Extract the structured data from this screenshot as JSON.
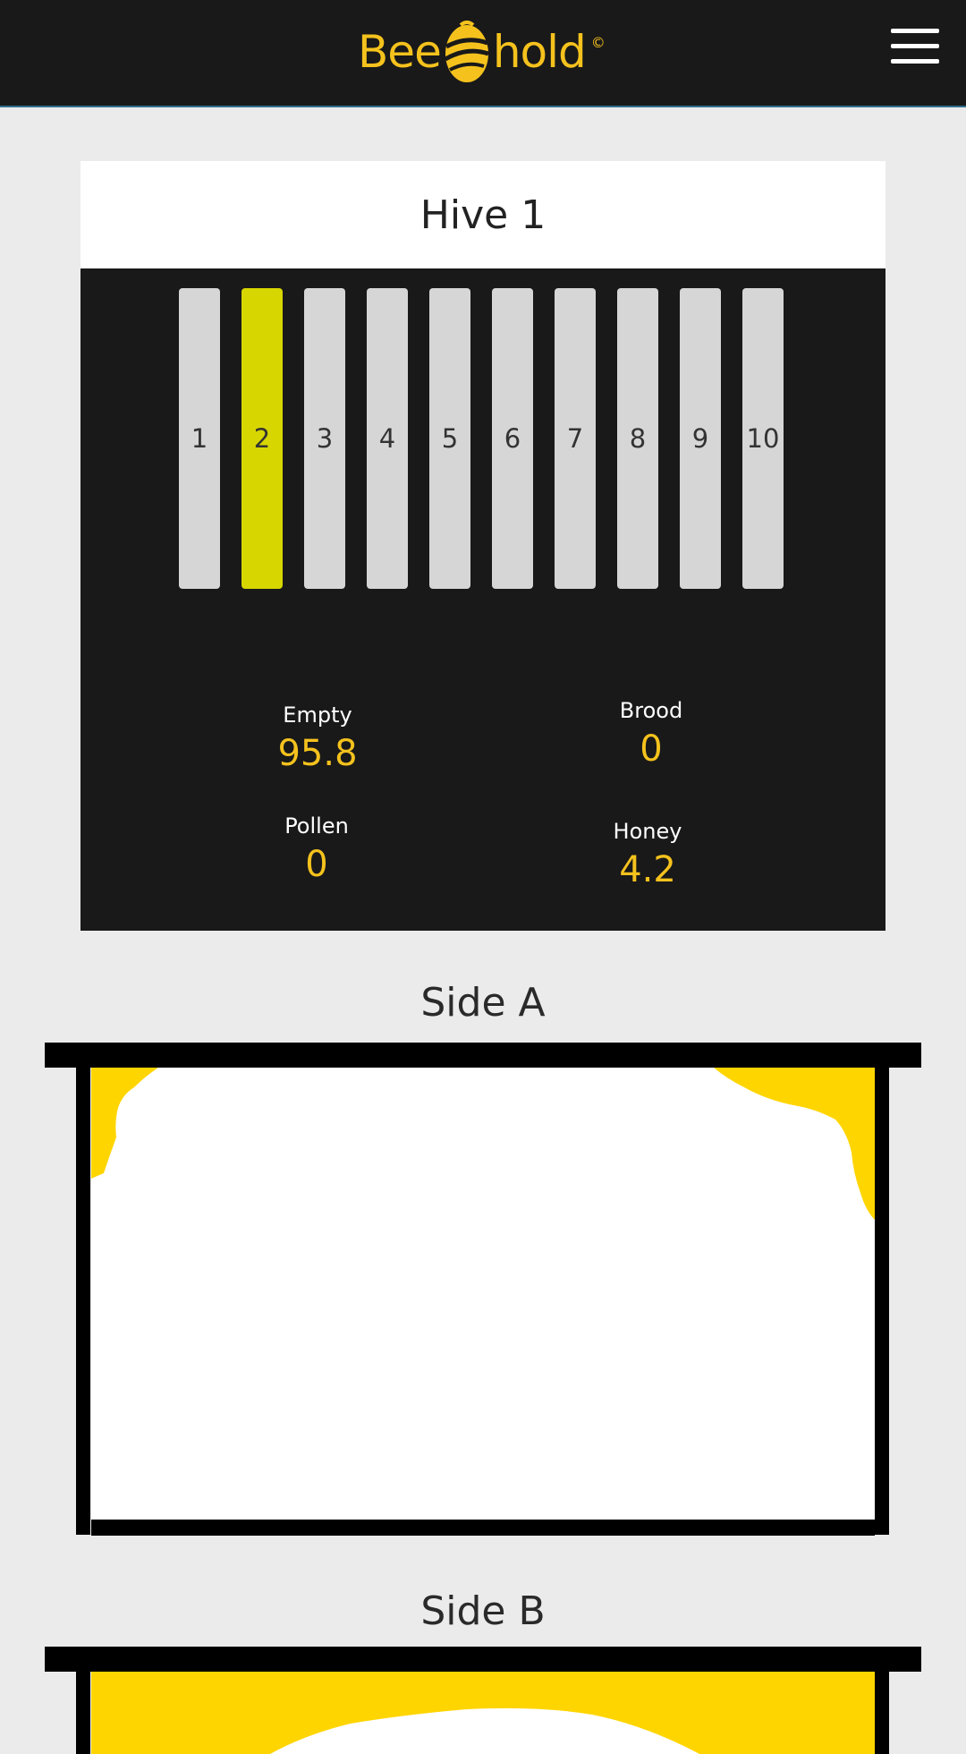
{
  "header": {
    "logo_left": "Bee",
    "logo_right": "hold",
    "logo_mark": "©",
    "menu_icon": "hamburger-menu-icon"
  },
  "hive": {
    "title": "Hive 1",
    "frames": [
      "1",
      "2",
      "3",
      "4",
      "5",
      "6",
      "7",
      "8",
      "9",
      "10"
    ],
    "selected_frame": "2",
    "stats": {
      "empty": {
        "label": "Empty",
        "value": "95.8"
      },
      "brood": {
        "label": "Brood",
        "value": "0"
      },
      "pollen": {
        "label": "Pollen",
        "value": "0"
      },
      "honey": {
        "label": "Honey",
        "value": "4.2"
      }
    }
  },
  "sides": {
    "a": {
      "title": "Side A"
    },
    "b": {
      "title": "Side B"
    }
  },
  "colors": {
    "accent": "#f5c21d",
    "honey_fill": "#ffd500",
    "selected_frame": "#d7d600",
    "background": "#ecebeb",
    "dark": "#191919"
  }
}
